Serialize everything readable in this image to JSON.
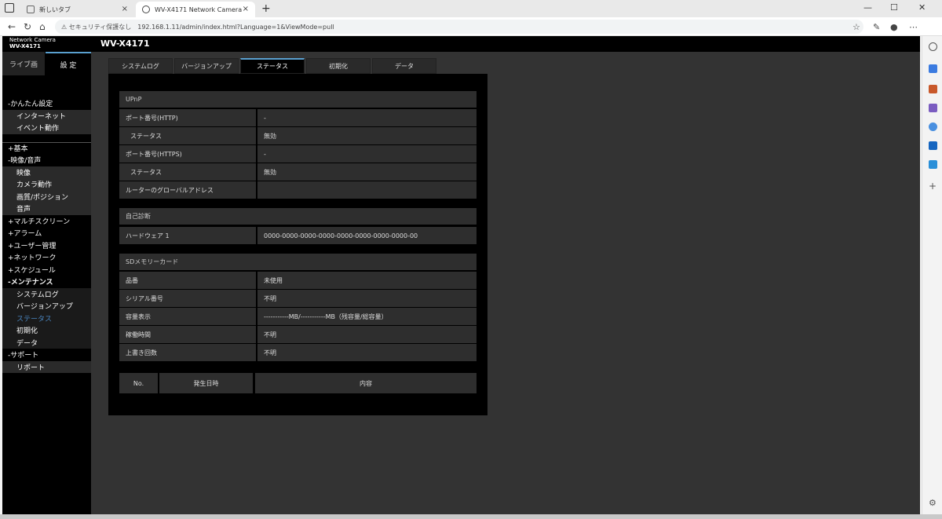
{
  "browser": {
    "tabs": [
      {
        "label": "新しいタブ"
      },
      {
        "label": "WV-X4171 Network Camera"
      }
    ],
    "security_label": "セキュリティ保護なし",
    "url": "192.168.1.11/admin/index.html?Language=1&ViewMode=pull"
  },
  "camera": {
    "brand_line1": "Network Camera",
    "brand_line2": "WV-X4171",
    "title": "WV-X4171",
    "mode_tabs": {
      "live": "ライブ画",
      "settings": "設 定"
    },
    "menu": [
      {
        "label": "-かんたん設定"
      },
      {
        "label": "インターネット"
      },
      {
        "label": "イベント動作"
      },
      {
        "label": "+基本"
      },
      {
        "label": "-映像/音声"
      },
      {
        "label": "映像"
      },
      {
        "label": "カメラ動作"
      },
      {
        "label": "画質/ポジション"
      },
      {
        "label": "音声"
      },
      {
        "label": "+マルチスクリーン"
      },
      {
        "label": "+アラーム"
      },
      {
        "label": "+ユーザー管理"
      },
      {
        "label": "+ネットワーク"
      },
      {
        "label": "+スケジュール"
      },
      {
        "label": "-メンテナンス"
      },
      {
        "label": "システムログ"
      },
      {
        "label": "バージョンアップ"
      },
      {
        "label": "ステータス"
      },
      {
        "label": "初期化"
      },
      {
        "label": "データ"
      },
      {
        "label": "-サポート"
      },
      {
        "label": "リポート"
      }
    ],
    "content_tabs": [
      {
        "label": "システムログ"
      },
      {
        "label": "バージョンアップ"
      },
      {
        "label": "ステータス"
      },
      {
        "label": "初期化"
      },
      {
        "label": "データ"
      }
    ],
    "upnp": {
      "header": "UPnP",
      "rows": [
        {
          "label": "ポート番号(HTTP)",
          "value": "-"
        },
        {
          "label": "ステータス",
          "value": "無効"
        },
        {
          "label": "ポート番号(HTTPS)",
          "value": "-"
        },
        {
          "label": "ステータス",
          "value": "無効"
        },
        {
          "label": "ルーターのグローバルアドレス",
          "value": ""
        }
      ]
    },
    "selfcheck": {
      "header": "自己診断",
      "rows": [
        {
          "label": "ハードウェア 1",
          "value": "0000-0000-0000-0000-0000-0000-0000-0000-00"
        }
      ]
    },
    "sd": {
      "header": "SDメモリーカード",
      "rows": [
        {
          "label": "品番",
          "value": "未使用"
        },
        {
          "label": "シリアル番号",
          "value": "不明"
        },
        {
          "label": "容量表示",
          "value": "-----------MB/-----------MB（残容量/総容量）"
        },
        {
          "label": "稼働時間",
          "value": "不明"
        },
        {
          "label": "上書き回数",
          "value": "不明"
        }
      ]
    },
    "log_columns": [
      "No.",
      "発生日時",
      "内容"
    ]
  }
}
